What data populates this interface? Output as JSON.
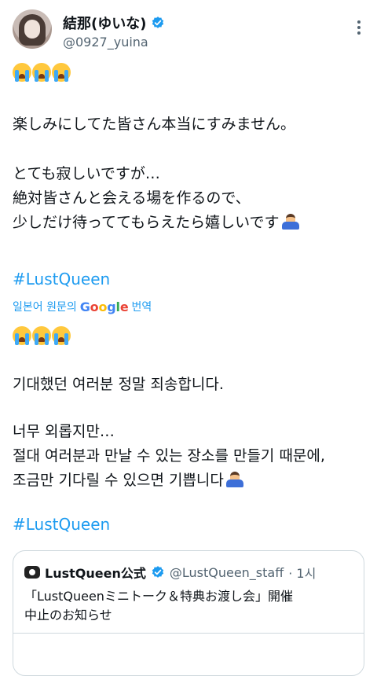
{
  "header": {
    "display_name": "結那(ゆいな)",
    "handle": "@0927_yuina"
  },
  "tweet": {
    "emoji_row_icons": [
      "loudly-crying-face",
      "loudly-crying-face",
      "loudly-crying-face"
    ],
    "lines_jp": [
      "楽しみにしてた皆さん本当にすみません。",
      "とても寂しいですが…",
      "絶対皆さんと会える場を作るので、",
      "少しだけ待っててもらえたら嬉しいです"
    ],
    "hashtag_jp": "#LustQueen",
    "translated_by_prefix": "일본어 원문의",
    "translated_by_suffix": "번역",
    "google_letters": [
      "G",
      "o",
      "o",
      "g",
      "l",
      "e"
    ],
    "lines_ko": [
      "기대했던 여러분 정말 죄송합니다.",
      "너무 외롭지만…",
      "절대 여러분과 만날 수 있는 장소를 만들기 때문에,",
      "조금만 기다릴 수 있으면 기쁩니다"
    ],
    "hashtag_ko": "#LustQueen",
    "emoji_end": "person-bowing"
  },
  "quote": {
    "name": "LustQueen公式",
    "handle": "@LustQueen_staff",
    "time": "· 1시",
    "text_line1": "「LustQueenミニトーク＆特典お渡し会」開催",
    "text_line2": "中止のお知らせ"
  },
  "colors": {
    "link": "#1d9bf0",
    "text": "#0f1419",
    "muted": "#536471",
    "verified": "#1d9bf0",
    "border": "#cfd9de"
  }
}
